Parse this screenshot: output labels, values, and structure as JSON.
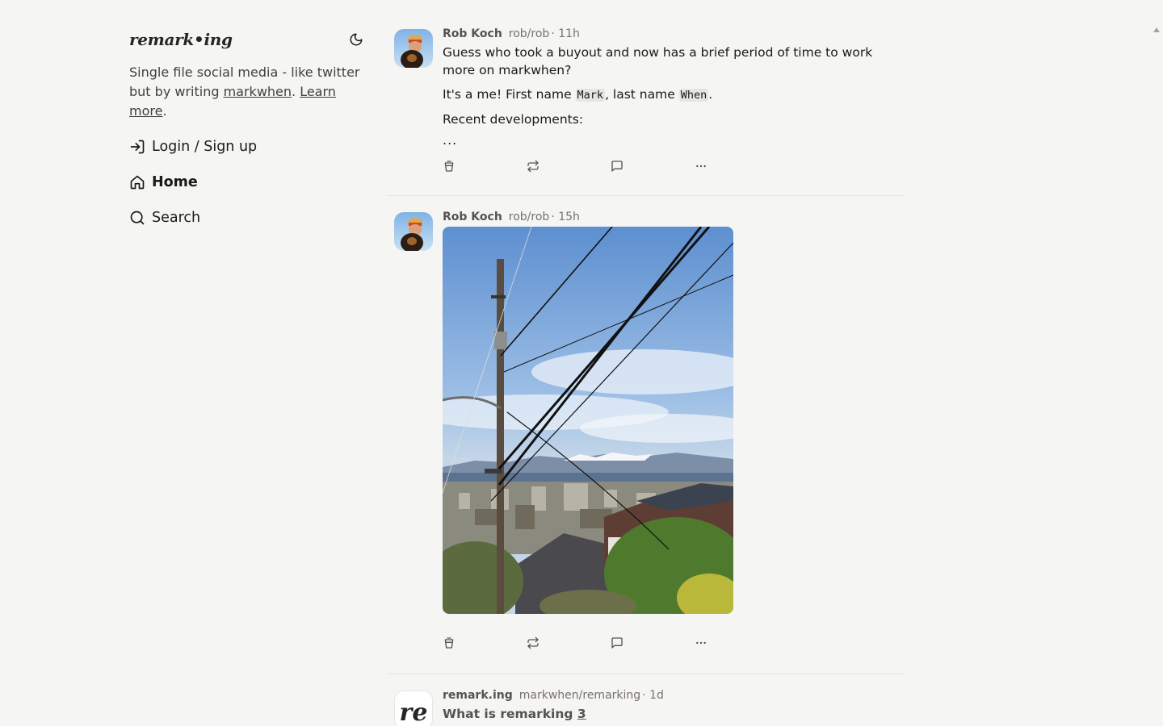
{
  "sidebar": {
    "brand": "remark•ing",
    "theme_toggle": "moon-icon",
    "tagline_pre": "Single file social media - like twitter but by writing ",
    "tagline_link1": "markwhen",
    "tagline_mid": ". ",
    "tagline_link2": "Learn more",
    "tagline_post": ".",
    "nav": [
      {
        "label": "Login / Sign up",
        "icon": "login-icon",
        "active": false
      },
      {
        "label": "Home",
        "icon": "home-icon",
        "active": true
      },
      {
        "label": "Search",
        "icon": "search-icon",
        "active": false
      }
    ]
  },
  "feed": {
    "posts": [
      {
        "author": "Rob Koch",
        "handle": "rob/rob",
        "time": "· 11h",
        "line1": "Guess who took a buyout and now has a brief period of time to work more on markwhen?",
        "line2_pre": "It's a me! First name ",
        "line2_code1": "Mark",
        "line2_mid": ", last name ",
        "line2_code2": "When",
        "line2_post": ".",
        "line3": "Recent developments:",
        "more": "..."
      },
      {
        "author": "Rob Koch",
        "handle": "rob/rob",
        "time": "· 15h",
        "image": "photo of utility pole, power lines and city view with mountains"
      },
      {
        "author": "remark.ing",
        "handle": "markwhen/remarking",
        "time": "· 1d",
        "avatar_text": "re",
        "title_pre": "What is remarking ",
        "title_link": "3"
      }
    ]
  },
  "colors": {
    "background": "#f5f5f4",
    "text": "#1c1917",
    "muted": "#78716c",
    "author": "#57534e",
    "divider": "#e7e5e4"
  }
}
